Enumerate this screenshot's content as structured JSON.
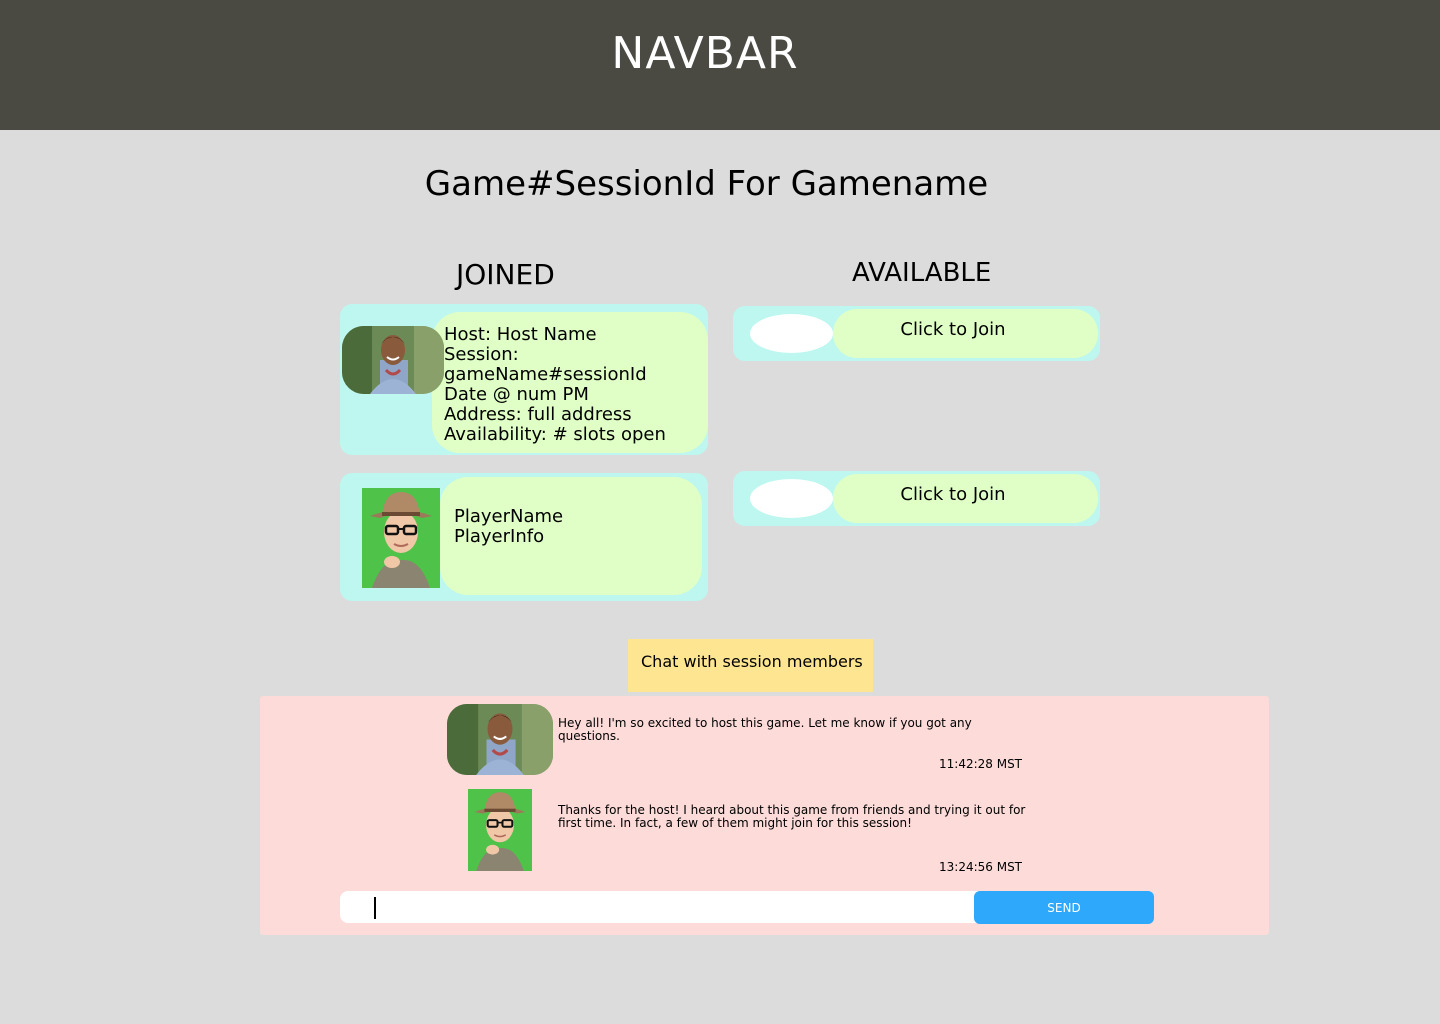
{
  "navbar": {
    "title": "NAVBAR"
  },
  "page": {
    "title": "Game#SessionId For Gamename"
  },
  "joined": {
    "heading": "JOINED",
    "host": {
      "host": "Host: Host Name",
      "session_label": "Session:",
      "session_value": "gameName#sessionId",
      "date": "Date @ num PM",
      "address": "Address: full address",
      "availability": "Availability: # slots open"
    },
    "player": {
      "name": "PlayerName",
      "info": "PlayerInfo"
    }
  },
  "available": {
    "heading": "AVAILABLE",
    "slots": [
      {
        "label": "Click to Join"
      },
      {
        "label": "Click to Join"
      }
    ]
  },
  "chat": {
    "tab_label": "Chat with session members",
    "messages": [
      {
        "text": "Hey all! I'm so excited to host this game. Let me know if you got any questions.",
        "time": "11:42:28 MST"
      },
      {
        "text": "Thanks for the host! I heard about this game from friends and trying it out for first time. In fact, a few of them might join for this session!",
        "time": "13:24:56 MST"
      }
    ],
    "input": {
      "value": "",
      "placeholder": ""
    },
    "send_label": "SEND"
  },
  "colors": {
    "navbar": "#4a4a42",
    "background": "#dcdcdc",
    "card_outer": "#bdf7ef",
    "card_inner": "#dfffc6",
    "chat_tab": "#fee592",
    "chat_panel": "#fcdbd9",
    "send_button": "#2ea8fb"
  }
}
